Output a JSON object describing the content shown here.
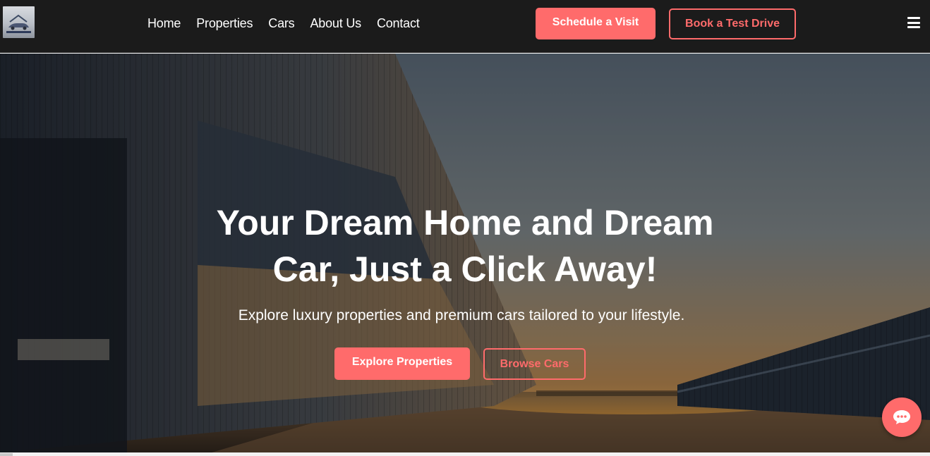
{
  "header": {
    "logo_icon": "house-and-car-logo",
    "nav": [
      "Home",
      "Properties",
      "Cars",
      "About Us",
      "Contact"
    ],
    "schedule_label": "Schedule a Visit",
    "test_drive_label": "Book a Test Drive",
    "menu_icon": "hamburger-menu-icon"
  },
  "hero": {
    "title_line1": "Your Dream Home and Dream",
    "title_line2": "Car, Just a Click Away!",
    "subtitle": "Explore luxury properties and premium cars tailored to your lifestyle.",
    "explore_label": "Explore Properties",
    "browse_label": "Browse Cars",
    "background_image": "warehouse-buildings-at-sunset"
  },
  "chat": {
    "icon": "chat-bubble-icon"
  },
  "colors": {
    "accent": "#ff6b6b",
    "header_bg": "#1b1b1b",
    "text_light": "#ffffff"
  }
}
